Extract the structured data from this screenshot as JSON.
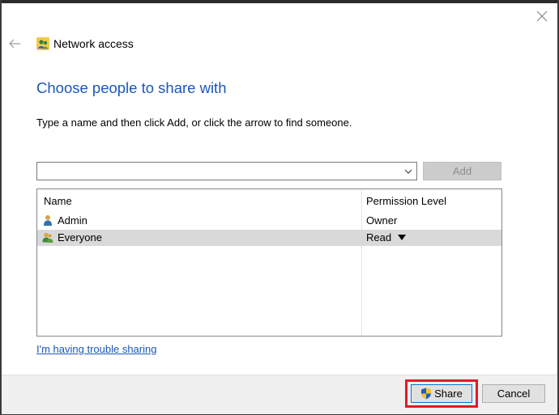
{
  "window": {
    "title": "Network access"
  },
  "main": {
    "heading": "Choose people to share with",
    "instructions": "Type a name and then click Add, or click the arrow to find someone.",
    "name_input": {
      "value": "",
      "placeholder": ""
    },
    "add_label": "Add"
  },
  "table": {
    "columns": [
      "Name",
      "Permission Level"
    ],
    "rows": [
      {
        "name": "Admin",
        "permission": "Owner",
        "icon": "user-icon",
        "selected": false
      },
      {
        "name": "Everyone",
        "permission": "Read",
        "icon": "group-icon",
        "selected": true
      }
    ]
  },
  "links": {
    "trouble": "I'm having trouble sharing"
  },
  "buttons": {
    "share": "Share",
    "cancel": "Cancel"
  },
  "colors": {
    "heading": "#1a56b8",
    "highlight": "#e01c24",
    "selected_row": "#d9d9d9"
  }
}
